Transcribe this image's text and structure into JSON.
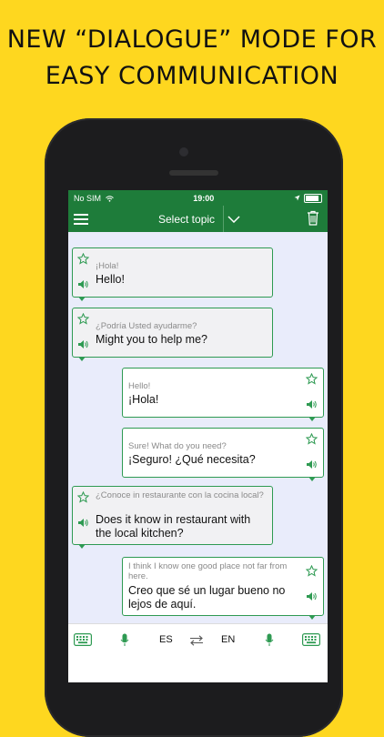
{
  "headline": {
    "line1": "NEW “DIALOGUE” MODE FOR",
    "line2": "EASY  COMMUNICATION"
  },
  "statusbar": {
    "carrier": "No SIM",
    "time": "19:00"
  },
  "navbar": {
    "menu_icon": "hamburger-icon",
    "title": "Select topic",
    "chevron_icon": "chevron-down-icon",
    "trash_icon": "trash-icon"
  },
  "messages": [
    {
      "side": "left",
      "translation": "¡Hola!",
      "original": "Hello!"
    },
    {
      "side": "left",
      "translation": "¿Podría Usted ayudarme?",
      "original": "Might you to help me?"
    },
    {
      "side": "right",
      "translation": "Hello!",
      "original": "¡Hola!"
    },
    {
      "side": "right",
      "translation": "Sure! What do you need?",
      "original": "¡Seguro! ¿Qué necesita?"
    },
    {
      "side": "left",
      "translation": "¿Conoce in restaurante con la cocina local?",
      "original": "Does it know in restaurant with the local kitchen?"
    },
    {
      "side": "right",
      "translation": "I think I know one good place not far from here.",
      "original": "Creo que sé un lugar bueno no lejos de aquí."
    }
  ],
  "bottombar": {
    "left_keyboard_icon": "keyboard-icon",
    "left_mic_icon": "microphone-icon",
    "lang_left": "ES",
    "swap_icon": "swap-arrows-icon",
    "lang_right": "EN",
    "right_mic_icon": "microphone-icon",
    "right_keyboard_icon": "keyboard-icon"
  },
  "colors": {
    "background": "#fed71f",
    "brand_green": "#1e7c3a",
    "bubble_border": "#2e9a52",
    "chat_bg": "#e9ecfb"
  }
}
